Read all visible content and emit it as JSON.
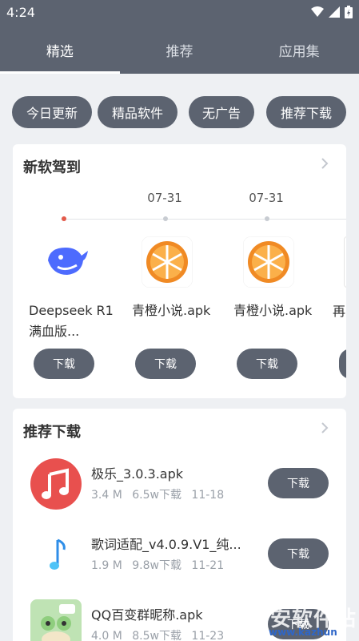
{
  "status": {
    "time": "4:24"
  },
  "tabs": [
    {
      "label": "精选",
      "active": true
    },
    {
      "label": "推荐",
      "active": false
    },
    {
      "label": "应用集",
      "active": false
    }
  ],
  "chips": [
    "今日更新",
    "精品软件",
    "无广告",
    "推荐下载"
  ],
  "new_section": {
    "title": "新软驾到",
    "dates": [
      "07-31",
      "07-31"
    ],
    "items": [
      {
        "name": "Deepseek R1满血版...",
        "button": "下载",
        "icon": "deepseek-whale-icon"
      },
      {
        "name": "青橙小说.apk",
        "button": "下载",
        "icon": "orange-slice-icon"
      },
      {
        "name": "青橙小说.apk",
        "button": "下载",
        "icon": "orange-slice-icon"
      },
      {
        "name": "再",
        "button": "",
        "icon": "app-icon"
      }
    ]
  },
  "recommend_section": {
    "title": "推荐下载",
    "items": [
      {
        "name": "极乐_3.0.3.apk",
        "size": "3.4 M",
        "downloads": "6.5w下载",
        "date": "11-18",
        "button": "下载",
        "icon": "music-note-icon"
      },
      {
        "name": "歌词适配_v4.0.9.V1_纯...",
        "size": "1.9 M",
        "downloads": "9.8w下载",
        "date": "11-21",
        "button": "下载",
        "icon": "blue-note-icon"
      },
      {
        "name": "QQ百变群昵称.apk",
        "size": "4.0 M",
        "downloads": "8.5w下载",
        "date": "11-23",
        "button": "下载",
        "icon": "frog-icon"
      }
    ]
  },
  "watermark": {
    "text": "安软件站",
    "url": "www.kazhun"
  },
  "colors": {
    "primary": "#5c6370",
    "background": "#eef0f3",
    "accent_dot": "#e35a4a"
  }
}
